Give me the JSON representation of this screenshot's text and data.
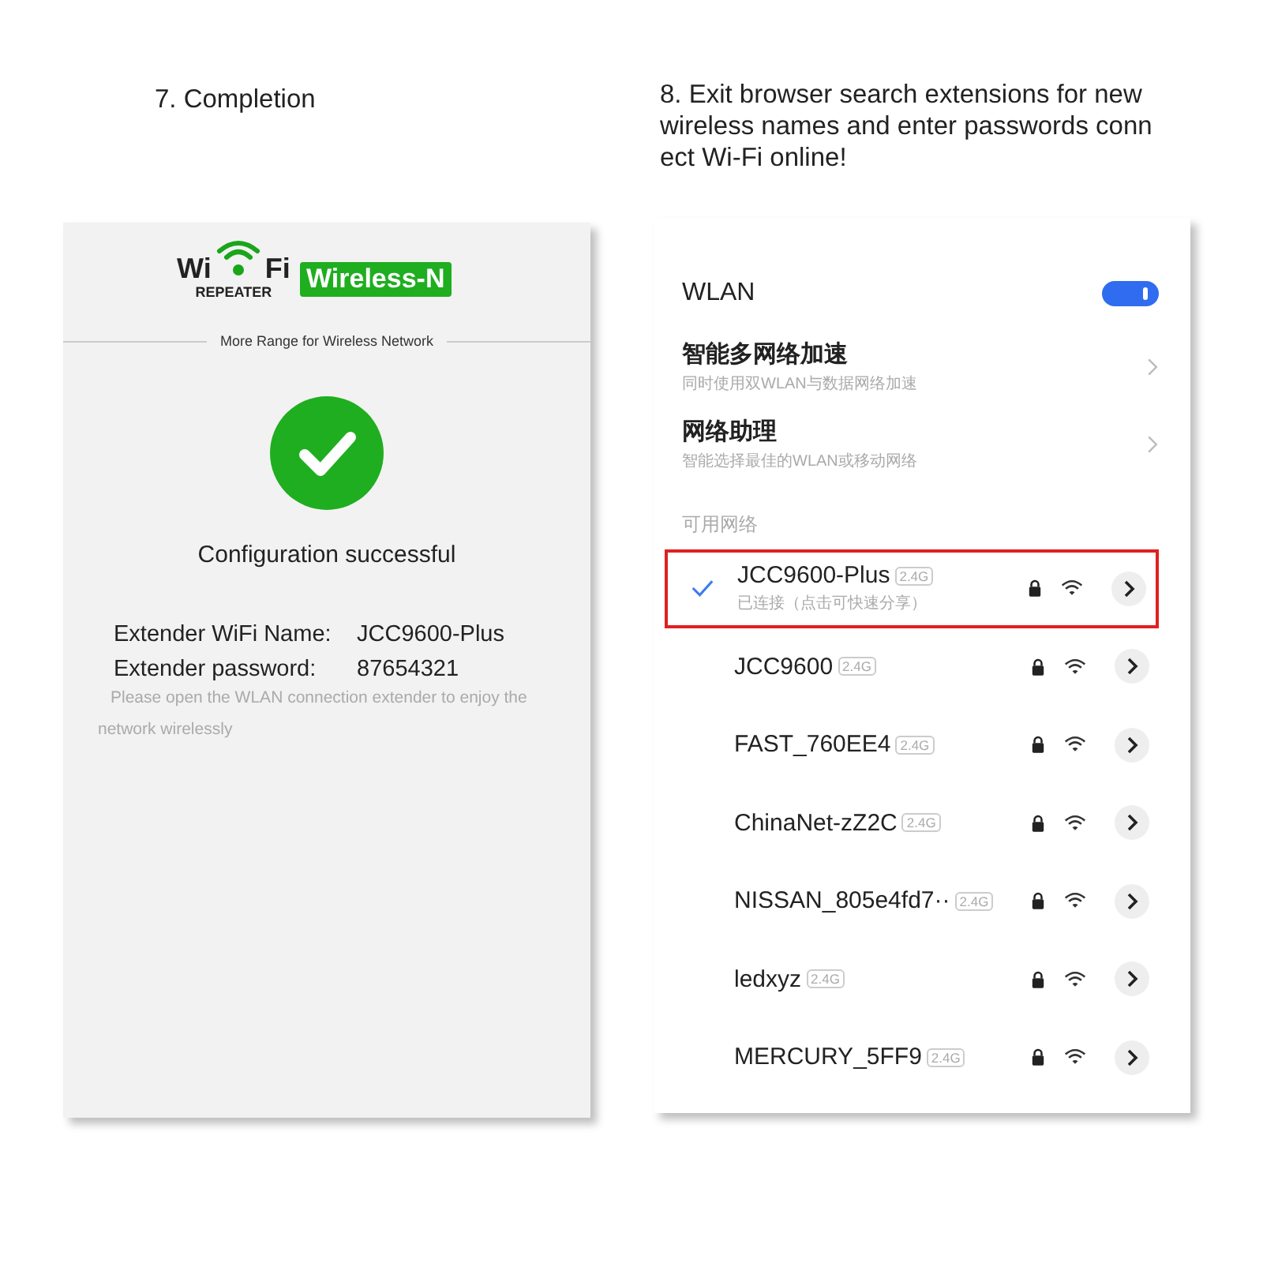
{
  "left": {
    "caption": "7. Completion",
    "screen": {
      "logo": {
        "word_1": "Wi",
        "word_2": "Fi",
        "subtitle": "REPEATER",
        "badge": "Wireless-N"
      },
      "tagline": "More Range for Wireless Network",
      "status": "Configuration successful",
      "fields": [
        {
          "label": "Extender WiFi Name:",
          "value": "JCC9600-Plus"
        },
        {
          "label": "Extender password:",
          "value": "87654321"
        }
      ],
      "note": "Please open the WLAN connection extender to enjoy the network wirelessly"
    }
  },
  "right": {
    "caption": "8. Exit browser search extensions for new wireless names and enter passwords connect Wi-Fi online!",
    "screen": {
      "title": "WLAN",
      "toggle": {
        "on": true
      },
      "settings": [
        {
          "title": "智能多网络加速",
          "subtitle": "同时使用双WLAN与数据网络加速"
        },
        {
          "title": "网络助理",
          "subtitle": "智能选择最佳的WLAN或移动网络"
        }
      ],
      "section": "可用网络",
      "networks": [
        {
          "name": "JCC9600-Plus",
          "band": "2.4G",
          "status": "已连接（点击可快速分享）",
          "connected": true,
          "highlighted": true
        },
        {
          "name": "JCC9600",
          "band": "2.4G",
          "connected": false,
          "highlighted": false
        },
        {
          "name": "FAST_760EE4",
          "band": "2.4G",
          "connected": false,
          "highlighted": false
        },
        {
          "name": "ChinaNet-zZ2C",
          "band": "2.4G",
          "connected": false,
          "highlighted": false
        },
        {
          "name": "NISSAN_805e4fd7··",
          "band": "2.4G",
          "connected": false,
          "highlighted": false
        },
        {
          "name": "ledxyz",
          "band": "2.4G",
          "connected": false,
          "highlighted": false
        },
        {
          "name": "MERCURY_5FF9",
          "band": "2.4G",
          "connected": false,
          "highlighted": false
        }
      ]
    }
  }
}
